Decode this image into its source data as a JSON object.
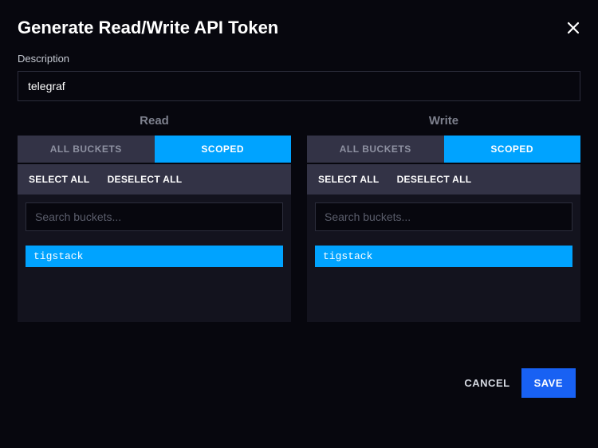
{
  "header": {
    "title": "Generate Read/Write API Token"
  },
  "description": {
    "label": "Description",
    "value": "telegraf"
  },
  "panels": {
    "read": {
      "title": "Read",
      "toggle_all": "ALL BUCKETS",
      "toggle_scoped": "SCOPED",
      "select_all": "SELECT ALL",
      "deselect_all": "DESELECT ALL",
      "search_placeholder": "Search buckets...",
      "buckets": [
        "tigstack"
      ]
    },
    "write": {
      "title": "Write",
      "toggle_all": "ALL BUCKETS",
      "toggle_scoped": "SCOPED",
      "select_all": "SELECT ALL",
      "deselect_all": "DESELECT ALL",
      "search_placeholder": "Search buckets...",
      "buckets": [
        "tigstack"
      ]
    }
  },
  "footer": {
    "cancel": "CANCEL",
    "save": "SAVE"
  }
}
